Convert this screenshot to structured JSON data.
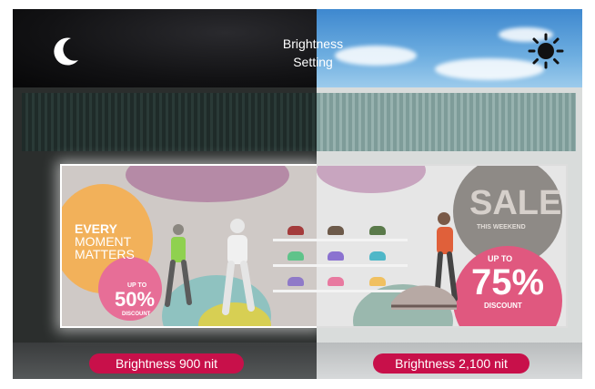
{
  "title_line1": "Brightness",
  "title_line2": "Setting",
  "left_label": "Brightness 900 nit",
  "right_label": "Brightness 2,100 nit",
  "icons": {
    "left": "moon-icon",
    "right": "sun-icon"
  },
  "display_left": {
    "headline_line1": "EVERY",
    "headline_line2": "MOMENT",
    "headline_line3": "MATTERS",
    "badge_top": "UP TO",
    "badge_value": "50%",
    "badge_bottom": "DISCOUNT"
  },
  "display_right": {
    "sale": "SALE",
    "sale_sub": "THIS WEEKEND",
    "badge_top": "UP TO",
    "badge_value": "75%",
    "badge_bottom": "DISCOUNT"
  },
  "colors": {
    "pill": "#c8104a",
    "sky_day": "#6eaee0",
    "sky_night": "#121214"
  }
}
